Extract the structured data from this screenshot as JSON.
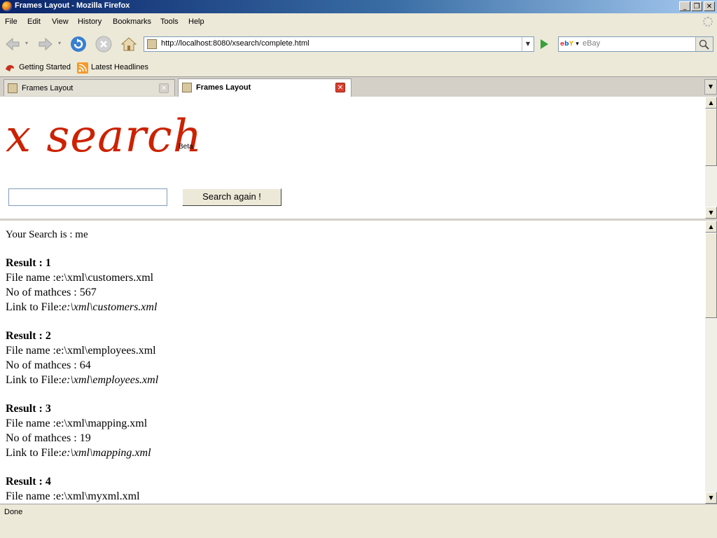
{
  "window": {
    "title": "Frames Layout - Mozilla Firefox"
  },
  "menu": {
    "items": [
      "File",
      "Edit",
      "View",
      "History",
      "Bookmarks",
      "Tools",
      "Help"
    ]
  },
  "nav": {
    "url": "http://localhost:8080/xsearch/complete.html",
    "search_placeholder": "eBay",
    "search_engine": "ebY"
  },
  "bookmarks": {
    "items": [
      "Getting Started",
      "Latest Headlines"
    ]
  },
  "tabs": [
    {
      "label": "Frames Layout",
      "active": false
    },
    {
      "label": "Frames Layout",
      "active": true
    }
  ],
  "top_frame": {
    "logo": "x search",
    "beta": "Beta",
    "query_value": "",
    "search_button": "Search again !"
  },
  "bottom_frame": {
    "search_line": "Your Search is : me",
    "results": [
      {
        "heading": "Result : 1",
        "file_name": "File name :e:\\xml\\customers.xml",
        "matches": "No of mathces : 567",
        "link_label": "Link to File:",
        "link": "e:\\xml\\customers.xml"
      },
      {
        "heading": "Result : 2",
        "file_name": "File name :e:\\xml\\employees.xml",
        "matches": "No of mathces : 64",
        "link_label": "Link to File:",
        "link": "e:\\xml\\employees.xml"
      },
      {
        "heading": "Result : 3",
        "file_name": "File name :e:\\xml\\mapping.xml",
        "matches": "No of mathces : 19",
        "link_label": "Link to File:",
        "link": "e:\\xml\\mapping.xml"
      },
      {
        "heading": "Result : 4",
        "file_name": "File name :e:\\xml\\myxml.xml"
      }
    ]
  },
  "status": {
    "text": "Done"
  },
  "colors": {
    "logo": "#cc2200",
    "titlebar": "#0a246a"
  }
}
